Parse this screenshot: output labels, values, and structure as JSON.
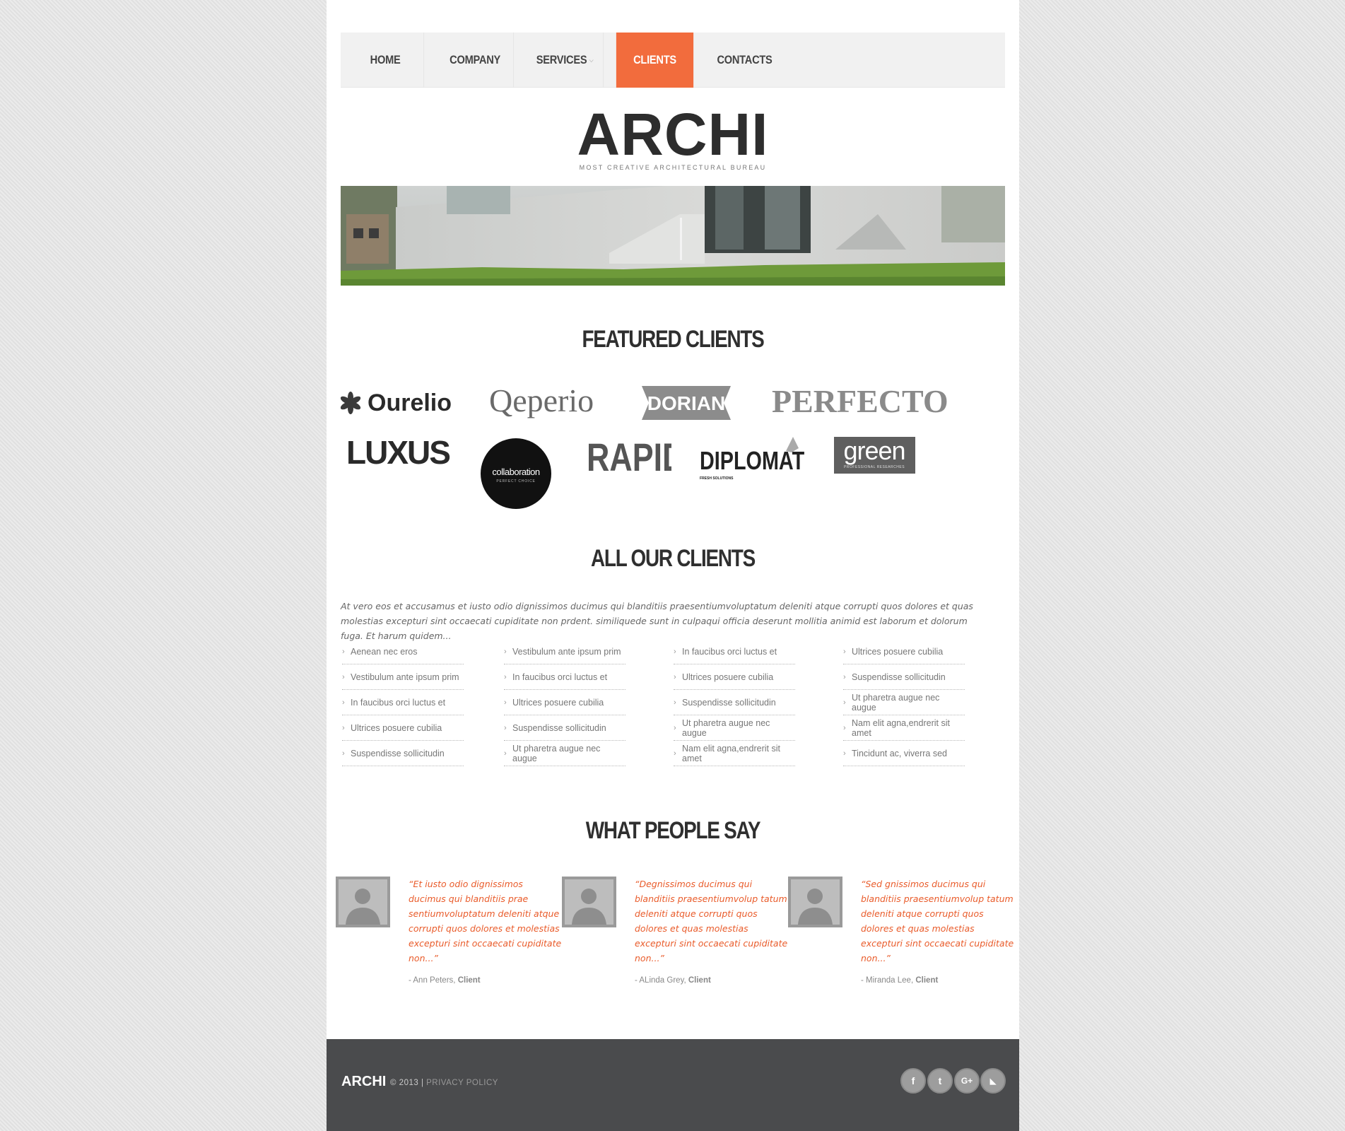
{
  "nav": {
    "items": [
      {
        "label": "HOME"
      },
      {
        "label": "COMPANY"
      },
      {
        "label": "SERVICES"
      },
      {
        "label": "CLIENTS"
      },
      {
        "label": "CONTACTS"
      }
    ],
    "active": "CLIENTS"
  },
  "brand": {
    "name": "ARCHI",
    "tagline": "MOST CREATIVE ARCHITECTURAL BUREAU"
  },
  "featured": {
    "heading": "FEATURED CLIENTS",
    "logos": [
      "Ourelio",
      "Qeperio",
      "DORIAN",
      "PERFECTO",
      "LUXUS",
      "collaboration",
      "RAPID",
      "DIPLOMAT",
      "green"
    ],
    "logo_sublabels": {
      "collaboration": "PERFECT CHOICE",
      "diplomat": "FRESH SOLUTIONS",
      "green": "PROFESSIONAL RESEARCHES"
    }
  },
  "all_clients": {
    "heading": "ALL OUR CLIENTS",
    "intro": "At vero eos et accusamus et iusto odio dignissimos ducimus qui blanditiis praesentiumvoluptatum deleniti atque corrupti quos dolores et quas molestias excepturi sint occaecati cupiditate non prdent. similiquede sunt in culpaqui officia deserunt mollitia animid est laborum et dolorum fuga. Et harum quidem...",
    "columns": [
      [
        "Aenean nec eros",
        "Vestibulum ante ipsum prim",
        "In faucibus orci luctus et",
        "Ultrices posuere cubilia",
        "Suspendisse sollicitudin"
      ],
      [
        "Vestibulum ante ipsum prim",
        "In faucibus orci luctus et",
        "Ultrices posuere cubilia",
        "Suspendisse sollicitudin",
        "Ut pharetra augue nec augue"
      ],
      [
        "In faucibus orci luctus et",
        "Ultrices posuere cubilia",
        "Suspendisse sollicitudin",
        "Ut pharetra augue nec augue",
        "Nam elit agna,endrerit sit amet"
      ],
      [
        "Ultrices posuere cubilia",
        "Suspendisse sollicitudin",
        "Ut pharetra augue nec augue",
        "Nam elit agna,endrerit sit amet",
        "Tincidunt ac, viverra sed"
      ]
    ]
  },
  "testimonials": {
    "heading": "WHAT PEOPLE SAY",
    "items": [
      {
        "quote": "“Et iusto odio dignissimos ducimus qui blanditiis prae sentiumvoluptatum deleniti atque corrupti quos dolores et molestias excepturi sint occaecati cupiditate non...”",
        "name": "- Ann Peters, ",
        "role": "Client"
      },
      {
        "quote": "“Degnissimos ducimus qui blanditiis praesentiumvolup tatum deleniti atque corrupti quos dolores et quas molestias excepturi sint occaecati cupiditate non...”",
        "name": "- ALinda Grey, ",
        "role": "Client"
      },
      {
        "quote": "“Sed gnissimos ducimus qui blanditiis praesentiumvolup tatum deleniti atque corrupti quos dolores et quas molestias excepturi sint occaecati cupiditate non...”",
        "name": "- Miranda Lee, ",
        "role": "Client"
      }
    ]
  },
  "footer": {
    "brand": "ARCHI",
    "copyright": "© 2013 | ",
    "privacy": "PRIVACY POLICY",
    "social": [
      {
        "icon": "facebook-icon",
        "glyph": "f"
      },
      {
        "icon": "twitter-icon",
        "glyph": "t"
      },
      {
        "icon": "google-plus-icon",
        "glyph": "G+"
      },
      {
        "icon": "rss-icon",
        "glyph": "◣"
      }
    ]
  },
  "colors": {
    "accent": "#f26c3d",
    "quote": "#e95b2a",
    "footer_bg": "#4a4b4d"
  }
}
